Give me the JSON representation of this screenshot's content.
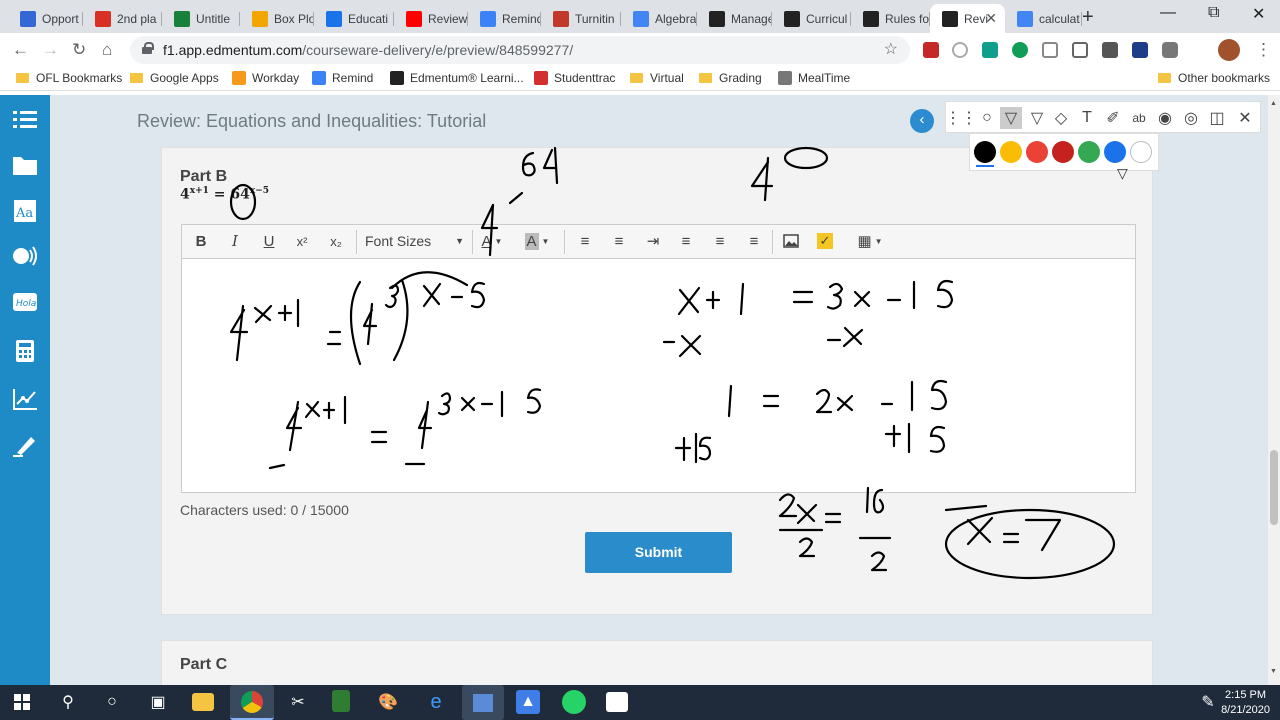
{
  "browser": {
    "tabs": [
      {
        "label": "Opport",
        "icon": "calendar-icon",
        "color": "#3367d6"
      },
      {
        "label": "2nd pla",
        "icon": "gmail-icon",
        "color": "#d93025"
      },
      {
        "label": "Untitle",
        "icon": "sheets-icon",
        "color": "#188038"
      },
      {
        "label": "Box Plo",
        "icon": "boxplot-icon",
        "color": "#f2a600"
      },
      {
        "label": "Educati",
        "icon": "education-icon",
        "color": "#1a73e8"
      },
      {
        "label": "Review",
        "icon": "youtube-icon",
        "color": "#ff0000"
      },
      {
        "label": "Remind",
        "icon": "remind-icon",
        "color": "#3b82f6"
      },
      {
        "label": "Turnitin",
        "icon": "turnitin-icon",
        "color": "#c0392b"
      },
      {
        "label": "Algebra",
        "icon": "docs-icon",
        "color": "#4285f4"
      },
      {
        "label": "Manage",
        "icon": "edmentum-icon",
        "color": "#222222"
      },
      {
        "label": "Curricul",
        "icon": "edmentum-icon",
        "color": "#222222"
      },
      {
        "label": "Rules fo",
        "icon": "edmentum-icon",
        "color": "#222222"
      },
      {
        "label": "Revi",
        "icon": "edmentum-icon",
        "color": "#222222",
        "active": true
      },
      {
        "label": "calculat",
        "icon": "google-icon",
        "color": "#4285f4"
      }
    ],
    "url_host": "f1.app.edmentum.com",
    "url_path": "/courseware-delivery/e/preview/848599277/",
    "bookmarks": [
      {
        "label": "OFL Bookmarks",
        "icon": "folder-icon"
      },
      {
        "label": "Google Apps",
        "icon": "folder-icon"
      },
      {
        "label": "Workday",
        "icon": "workday-icon"
      },
      {
        "label": "Remind",
        "icon": "remind-icon"
      },
      {
        "label": "Edmentum® Learni...",
        "icon": "edmentum-icon"
      },
      {
        "label": "Studenttrac",
        "icon": "studenttrac-icon"
      },
      {
        "label": "Virtual",
        "icon": "folder-icon"
      },
      {
        "label": "Grading",
        "icon": "folder-icon"
      },
      {
        "label": "MealTime",
        "icon": "clock-icon"
      }
    ],
    "other_bookmarks": "Other bookmarks"
  },
  "page": {
    "title": "Review: Equations and Inequalities: Tutorial",
    "part_b": "Part B",
    "part_c": "Part C",
    "equation": {
      "base": "4",
      "left_exp": "x+1",
      "equals": "=",
      "right_base": "64",
      "right_exp": "x−5"
    },
    "editor_toolbar": {
      "font_sizes": "Font Sizes",
      "bold": "B",
      "italic": "I",
      "underline": "U",
      "superscript": "x²",
      "subscript": "x₂"
    },
    "char_count": "Characters used: 0 / 15000",
    "submit": "Submit"
  },
  "annotation": {
    "colors": [
      "#000000",
      "#fbbc05",
      "#ea4335",
      "#c5221f",
      "#34a853",
      "#1a73e8",
      "#ffffff"
    ]
  },
  "taskbar": {
    "time": "2:15 PM",
    "date": "8/21/2020"
  }
}
